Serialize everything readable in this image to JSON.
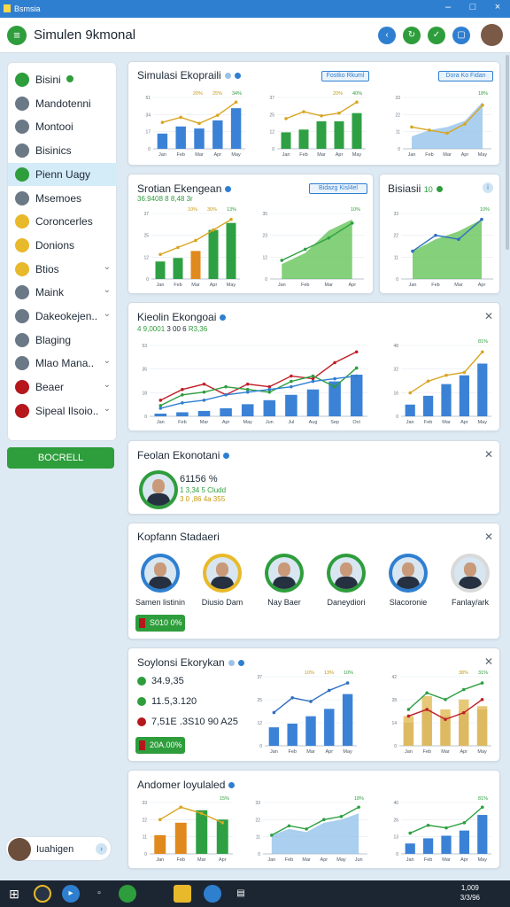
{
  "window": {
    "title": "Bsmsia"
  },
  "app": {
    "title": "Simulen 9kmonal"
  },
  "header_buttons": [
    {
      "name": "back-button",
      "color": "#2f7fd1",
      "glyph": "‹"
    },
    {
      "name": "refresh-button",
      "color": "#2e9d3c",
      "glyph": "↻"
    },
    {
      "name": "check-button",
      "color": "#2e9d3c",
      "glyph": "✓"
    },
    {
      "name": "window-button",
      "color": "#2f7fd1",
      "glyph": "▢"
    }
  ],
  "sidebar": {
    "items": [
      {
        "label": "Bisini",
        "icon": "leaf-icon",
        "color": "#2e9d3c",
        "badge": true
      },
      {
        "label": "Mandotenni",
        "icon": "gear-icon",
        "color": "#6b7885"
      },
      {
        "label": "Montooi",
        "icon": "gear-icon",
        "color": "#6b7885"
      },
      {
        "label": "Bisinics",
        "icon": "list-icon",
        "color": "#6b7885"
      },
      {
        "label": "Pienn Uagy",
        "icon": "chart-icon",
        "color": "#2e9d3c",
        "selected": true
      },
      {
        "label": "Msemoes",
        "icon": "list-icon",
        "color": "#6b7885"
      },
      {
        "label": "Coroncerles",
        "icon": "coin-icon",
        "color": "#e8b92a"
      },
      {
        "label": "Donions",
        "icon": "coin-icon",
        "color": "#e8b92a"
      },
      {
        "label": "Btios",
        "icon": "shield-icon",
        "color": "#e8b92a",
        "chevron": true
      },
      {
        "label": "Maink",
        "icon": "image-icon",
        "color": "#6b7885",
        "chevron": true
      },
      {
        "label": "Dakeokejen..",
        "icon": "doc-icon",
        "color": "#6b7885",
        "chevron": true
      },
      {
        "label": "Blaging",
        "icon": "doc-icon",
        "color": "#6b7885"
      },
      {
        "label": "Mlao Mana..",
        "icon": "doc-icon",
        "color": "#6b7885",
        "chevron": true
      },
      {
        "label": "Beaer",
        "icon": "car-icon",
        "color": "#b5171c",
        "chevron": true
      },
      {
        "label": "Sipeal Ilsoio..",
        "icon": "circle-icon",
        "color": "#b5171c",
        "chevron": true
      }
    ],
    "button": "BOCRELL",
    "user": "Iuahigen"
  },
  "cards": {
    "c1": {
      "title": "Simulasi Ekopraili",
      "pill1": "Fostko Rkuml",
      "pill2": "Dora Ko Fidan"
    },
    "c2": {
      "title": "Srotian Ekengean",
      "pill": "Bidazg Kisl4el",
      "sub": "36.9408 8 8,48 3r"
    },
    "c3": {
      "title": "Bisiasii",
      "badge": "10"
    },
    "c4": {
      "title": "Kieolin Ekongoai",
      "sub1": "4 9,0001",
      "sub2": "3 00 6",
      "sub3": "R3,36"
    },
    "c5": {
      "title": "Feolan Ekonotani",
      "value": "61156 %",
      "line1": "1 3,34 5 Cludd",
      "line2": "3 0 ,86 4a 355"
    },
    "c6": {
      "title": "Kopfann Stadaeri",
      "people": [
        {
          "name": "Samen listinin",
          "ring": "#2f7fd1"
        },
        {
          "name": "Diusio Dam",
          "ring": "#e8b92a"
        },
        {
          "name": "Nay Baer",
          "ring": "#2e9d3c"
        },
        {
          "name": "Daneydiori",
          "ring": "#2e9d3c"
        },
        {
          "name": "Slacoronie",
          "ring": "#2f7fd1"
        },
        {
          "name": "Fanlay/ark",
          "ring": "#d9d9d9"
        }
      ],
      "button": "S010 0%"
    },
    "c7": {
      "title": "Soylonsi Ekorykan",
      "stats": [
        {
          "value": "34.9,35",
          "color": "#2e9d3c"
        },
        {
          "value": "11.5,3.120",
          "color": "#2e9d3c"
        },
        {
          "value": "7,51E .3S10 90 A25",
          "color": "#b5171c"
        }
      ],
      "button": "20A.00%"
    },
    "c8": {
      "title": "Andomer loyulaled"
    }
  },
  "chart_data": [
    {
      "type": "bar",
      "title": "",
      "categories": [
        "Jan",
        "Feb",
        "Mar",
        "Apr",
        "May"
      ],
      "values": [
        15,
        22,
        20,
        28,
        40
      ],
      "line": [
        26,
        31,
        25,
        33,
        46
      ],
      "labels": [
        "20%",
        "25%",
        "34%"
      ]
    },
    {
      "type": "bar",
      "categories": [
        "Jan",
        "Feb",
        "Mar",
        "Apr",
        "May"
      ],
      "values": [
        12,
        14,
        20,
        20,
        26
      ],
      "line": [
        22,
        27,
        24,
        26,
        34
      ],
      "labels": [
        "20%",
        "40%"
      ]
    },
    {
      "type": "area",
      "categories": [
        "Jan",
        "Feb",
        "Mar",
        "Apr",
        "May"
      ],
      "values": [
        8,
        12,
        14,
        18,
        30
      ],
      "line": [
        14,
        12,
        10,
        16,
        28
      ],
      "labels": [
        "18%"
      ]
    },
    {
      "type": "bar",
      "categories": [
        "Jan",
        "Feb",
        "Mar",
        "Apr",
        "May"
      ],
      "values": [
        10,
        12,
        16,
        28,
        32
      ],
      "line": [
        14,
        18,
        22,
        28,
        34
      ],
      "labels": [
        "10%",
        "30%",
        "13%"
      ]
    },
    {
      "type": "area",
      "categories": [
        "Jan",
        "Feb",
        "Mar",
        "Apr"
      ],
      "values": [
        8,
        14,
        26,
        32
      ],
      "line": [
        10,
        16,
        22,
        30
      ],
      "labels": [
        "10%"
      ]
    },
    {
      "type": "area",
      "categories": [
        "Jan",
        "Feb",
        "Mar",
        "Apr"
      ],
      "values": [
        14,
        20,
        24,
        30
      ],
      "line": [
        14,
        22,
        20,
        30
      ],
      "labels": [
        "10%"
      ]
    },
    {
      "type": "line",
      "categories": [
        "Jan",
        "Feb",
        "Mar",
        "Apr",
        "May",
        "Jun",
        "Jul",
        "Aug",
        "Sep",
        "Oct"
      ],
      "series": [
        {
          "name": "",
          "values": [
            12,
            20,
            24,
            16,
            24,
            22,
            30,
            28,
            40,
            48
          ],
          "color": "#c0202a"
        },
        {
          "name": "",
          "values": [
            8,
            16,
            18,
            22,
            20,
            18,
            26,
            30,
            22,
            36
          ],
          "color": "#2e9d3c"
        },
        {
          "name": "",
          "values": [
            6,
            10,
            12,
            16,
            18,
            20,
            22,
            26,
            28,
            30
          ],
          "color": "#2f7fd1"
        }
      ],
      "bars": [
        2,
        3,
        4,
        6,
        9,
        12,
        16,
        20,
        26,
        31
      ]
    },
    {
      "type": "bar",
      "categories": [
        "Jan",
        "Feb",
        "Mar",
        "Apr",
        "May"
      ],
      "values": [
        8,
        14,
        22,
        28,
        36
      ],
      "line": [
        16,
        24,
        28,
        30,
        44
      ],
      "labels": [
        "81%"
      ]
    },
    {
      "type": "bar",
      "categories": [
        "Jan",
        "Feb",
        "Mar",
        "Apr",
        "May"
      ],
      "values": [
        10,
        12,
        16,
        20,
        28
      ],
      "line": [
        18,
        26,
        24,
        30,
        34
      ],
      "labels": [
        "10%",
        "13%",
        "10%"
      ]
    },
    {
      "type": "bar",
      "categories": [
        "Jan",
        "Feb",
        "Mar",
        "Apr",
        "May"
      ],
      "values": [
        18,
        30,
        22,
        28,
        24
      ],
      "series2": [
        14,
        22,
        18,
        20,
        22
      ],
      "line": [
        22,
        32,
        28,
        34,
        38
      ],
      "line2": [
        18,
        22,
        16,
        20,
        28
      ],
      "labels": [
        "38%",
        "31%"
      ]
    },
    {
      "type": "bar",
      "categories": [
        "Jan",
        "Feb",
        "Mar",
        "Apr"
      ],
      "values": [
        12,
        20,
        28,
        22
      ],
      "line": [
        22,
        30,
        26,
        20
      ],
      "labels": [
        "15%"
      ]
    },
    {
      "type": "area",
      "categories": [
        "Jan",
        "Feb",
        "Mar",
        "Apr",
        "May",
        "Jun"
      ],
      "values": [
        12,
        16,
        14,
        20,
        22,
        26
      ],
      "line": [
        12,
        18,
        16,
        22,
        24,
        30
      ],
      "labels": [
        "18%"
      ]
    },
    {
      "type": "bar",
      "categories": [
        "Jan",
        "Feb",
        "Mar",
        "Apr",
        "May"
      ],
      "values": [
        8,
        12,
        14,
        18,
        30
      ],
      "line": [
        16,
        22,
        20,
        24,
        36
      ],
      "labels": [
        "81%"
      ]
    }
  ],
  "taskbar": {
    "time": "1,009",
    "date": "3/3/96"
  }
}
